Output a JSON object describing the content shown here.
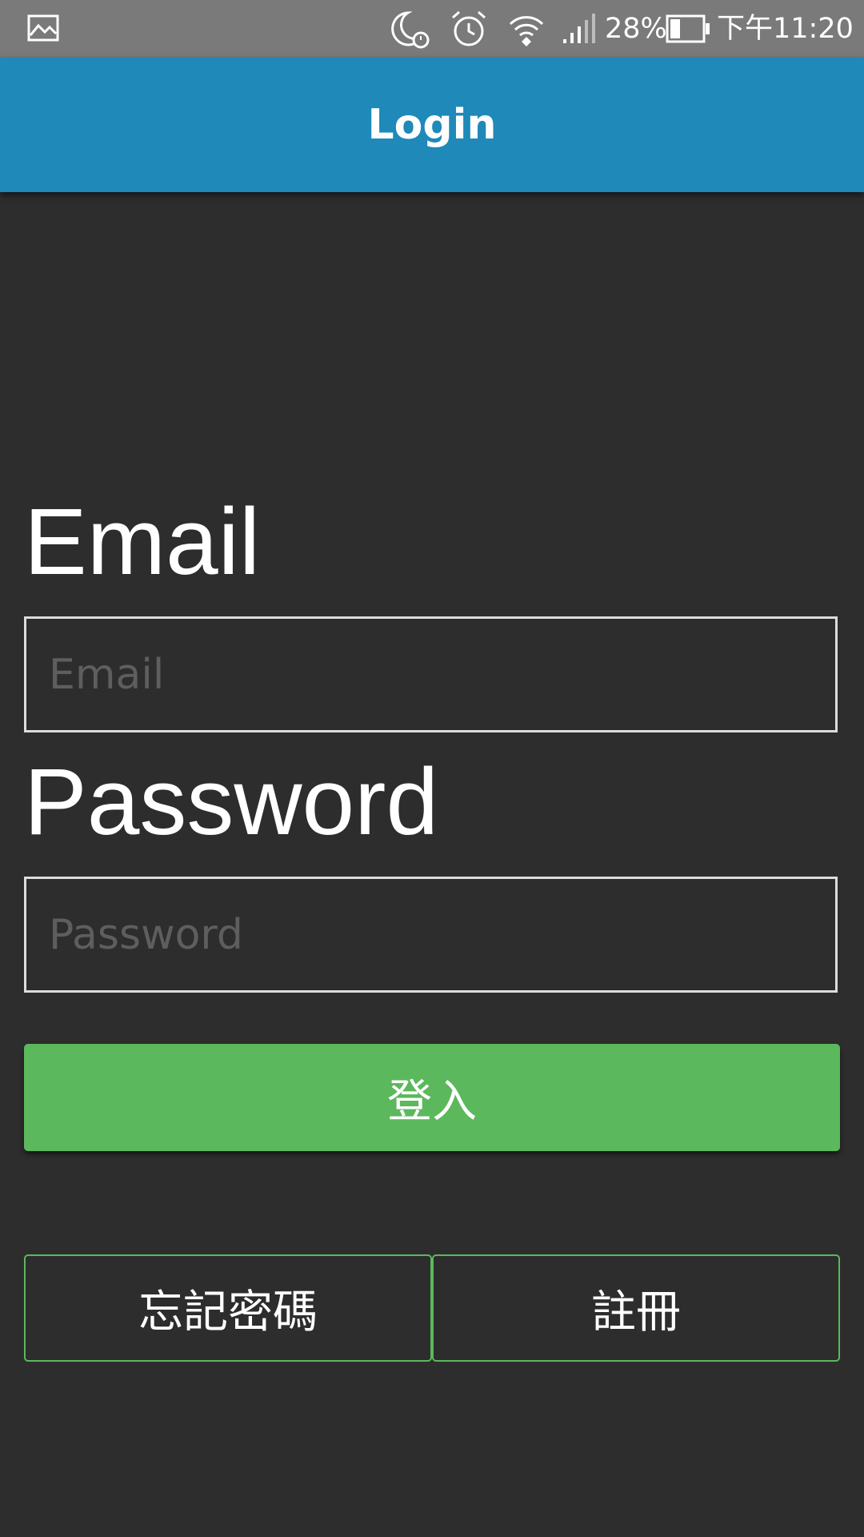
{
  "status_bar": {
    "battery_percent_label": "28%",
    "time": "下午11:20",
    "icons": [
      "gallery-notification-icon",
      "do-not-disturb-alarm-icon",
      "alarm-clock-icon",
      "wifi-icon",
      "signal-strength-icon",
      "battery-icon"
    ]
  },
  "app_bar": {
    "title": "Login",
    "color": "#1f89b9"
  },
  "form": {
    "email_label": "Email",
    "email_placeholder": "Email",
    "email_value": "",
    "password_label": "Password",
    "password_placeholder": "Password",
    "password_value": "",
    "login_button": "登入",
    "forgot_password_button": "忘記密碼",
    "register_button": "註冊"
  },
  "colors": {
    "background": "#2d2d2d",
    "status_bar": "#7a7a7a",
    "primary_green": "#5cb85c"
  }
}
